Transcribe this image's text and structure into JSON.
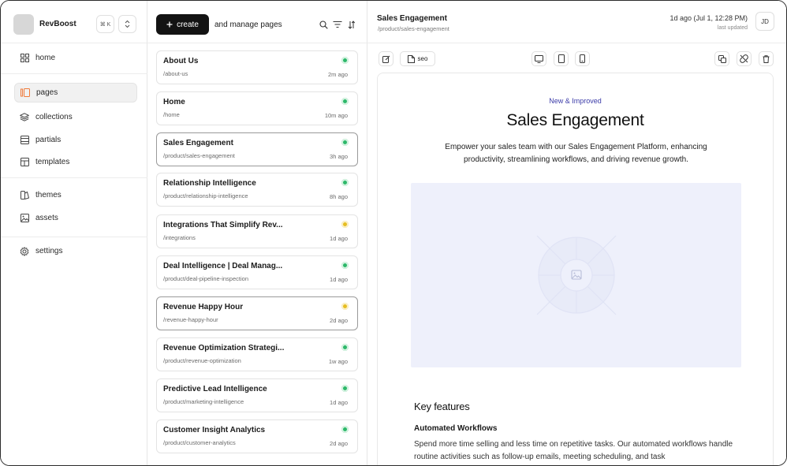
{
  "sidebar": {
    "brand": "RevBoost",
    "shortcut": "⌘ K",
    "items": [
      {
        "label": "home",
        "icon": "grid-icon"
      },
      {
        "label": "pages",
        "icon": "pages-icon",
        "active": true
      },
      {
        "label": "collections",
        "icon": "layers-icon"
      },
      {
        "label": "partials",
        "icon": "partials-icon"
      },
      {
        "label": "templates",
        "icon": "templates-icon"
      },
      {
        "label": "themes",
        "icon": "themes-icon"
      },
      {
        "label": "assets",
        "icon": "image-icon"
      },
      {
        "label": "settings",
        "icon": "gear-icon"
      }
    ]
  },
  "list": {
    "create_label": "create",
    "caption": "and manage pages",
    "pages": [
      {
        "title": "About Us",
        "path": "/about-us",
        "time": "2m ago",
        "status": "published"
      },
      {
        "title": "Home",
        "path": "/home",
        "time": "10m ago",
        "status": "published"
      },
      {
        "title": "Sales Engagement",
        "path": "/product/sales-engagement",
        "time": "3h ago",
        "status": "published"
      },
      {
        "title": "Relationship Intelligence",
        "path": "/product/relationship-intelligence",
        "time": "8h ago",
        "status": "published"
      },
      {
        "title": "Integrations That Simplify Rev...",
        "path": "/integrations",
        "time": "1d ago",
        "status": "draft"
      },
      {
        "title": "Deal Intelligence | Deal Manag...",
        "path": "/product/deal-pipeline-inspection",
        "time": "1d ago",
        "status": "published"
      },
      {
        "title": "Revenue Happy Hour",
        "path": "/revenue-happy-hour",
        "time": "2d ago",
        "status": "draft"
      },
      {
        "title": "Revenue Optimization Strategi...",
        "path": "/product/revenue-optimization",
        "time": "1w ago",
        "status": "published"
      },
      {
        "title": "Predictive Lead Intelligence",
        "path": "/product/marketing-intelligence",
        "time": "1d ago",
        "status": "published"
      },
      {
        "title": "Customer Insight Analytics",
        "path": "/product/customer-analytics",
        "time": "2d ago",
        "status": "published"
      }
    ]
  },
  "editor": {
    "title": "Sales Engagement",
    "path": "/product/sales-engagement",
    "updated": "1d ago (Jul 1, 12:28 PM)",
    "updated_label": "last updated",
    "avatar": "JD",
    "seo_label": "seo",
    "content": {
      "eyebrow": "New & Improved",
      "heading": "Sales Engagement",
      "description": "Empower your sales team with our Sales Engagement Platform, enhancing productivity, streamlining workflows, and driving revenue growth.",
      "section_title": "Key features",
      "feature_title": "Automated Workflows",
      "feature_desc": "Spend more time selling and less time on repetitive tasks. Our automated workflows handle routine activities such as follow-up emails, meeting scheduling, and task"
    }
  },
  "colors": {
    "accent": "#131313",
    "published": "#2db86a",
    "draft": "#e6be22",
    "eyebrow": "#3a3aa8",
    "placeholder_bg": "#eef0fb",
    "active_icon": "#f07a3a"
  }
}
